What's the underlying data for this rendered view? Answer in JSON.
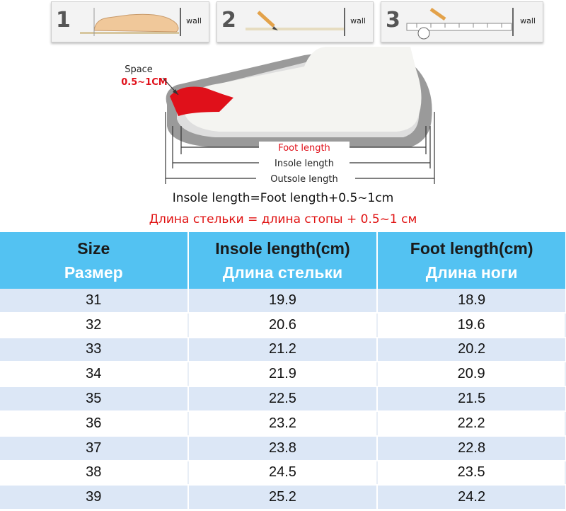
{
  "steps": [
    {
      "number": "1",
      "wall_label": "wall"
    },
    {
      "number": "2",
      "wall_label": "wall"
    },
    {
      "number": "3",
      "wall_label": "wall"
    }
  ],
  "diagram": {
    "space_label": "Space",
    "space_value": "0.5~1CM",
    "foot_length_label": "Foot length",
    "insole_length_label": "Insole length",
    "outsole_length_label": "Outsole length",
    "accent_color": "#e0101a"
  },
  "formula": {
    "en": "Insole length=Foot length+0.5~1cm",
    "ru": "Длина стельки = длина стопы + 0.5~1 см"
  },
  "table": {
    "header_color": "#53c2f2",
    "stripe_color": "#dce7f6",
    "headers": [
      {
        "en": "Size",
        "ru": "Размер"
      },
      {
        "en": "Insole length(cm)",
        "ru": "Длина стельки"
      },
      {
        "en": "Foot length(cm)",
        "ru": "Длина ноги"
      }
    ],
    "rows": [
      [
        "31",
        "19.9",
        "18.9"
      ],
      [
        "32",
        "20.6",
        "19.6"
      ],
      [
        "33",
        "21.2",
        "20.2"
      ],
      [
        "34",
        "21.9",
        "20.9"
      ],
      [
        "35",
        "22.5",
        "21.5"
      ],
      [
        "36",
        "23.2",
        "22.2"
      ],
      [
        "37",
        "23.8",
        "22.8"
      ],
      [
        "38",
        "24.5",
        "23.5"
      ],
      [
        "39",
        "25.2",
        "24.2"
      ]
    ]
  }
}
